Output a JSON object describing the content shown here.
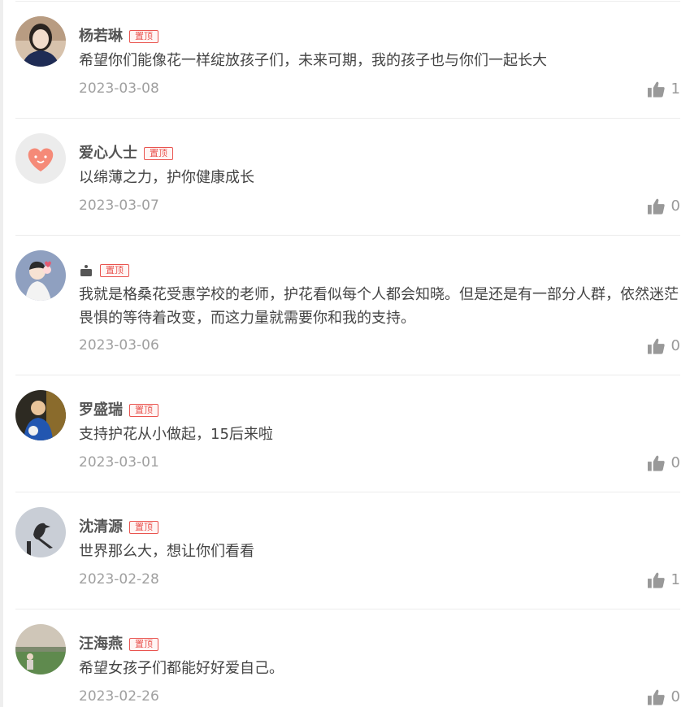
{
  "pinned_label": "置顶",
  "comments": [
    {
      "name": "杨若琳",
      "text": "希望你们能像花一样绽放孩子们，未来可期，我的孩子也与你们一起长大",
      "date": "2023-03-08",
      "likes": "1"
    },
    {
      "name": "爱心人士",
      "text": "以绵薄之力，护你健康成长",
      "date": "2023-03-07",
      "likes": "0"
    },
    {
      "name": "",
      "text": "我就是格桑花受惠学校的老师，护花看似每个人都会知晓。但是还是有一部分人群，依然迷茫畏惧的等待着改变，而这力量就需要你和我的支持。",
      "date": "2023-03-06",
      "likes": "0"
    },
    {
      "name": "罗盛瑞",
      "text": "支持护花从小做起，15后来啦",
      "date": "2023-03-01",
      "likes": "0"
    },
    {
      "name": "沈清源",
      "text": "世界那么大，想让你们看看",
      "date": "2023-02-28",
      "likes": "1"
    },
    {
      "name": "汪海燕",
      "text": "希望女孩子们都能好好爱自己。",
      "date": "2023-02-26",
      "likes": "0"
    }
  ],
  "colors": {
    "accent": "#e9544f",
    "date": "#a0a0a0",
    "divider": "#ececec",
    "icon": "#999999"
  }
}
